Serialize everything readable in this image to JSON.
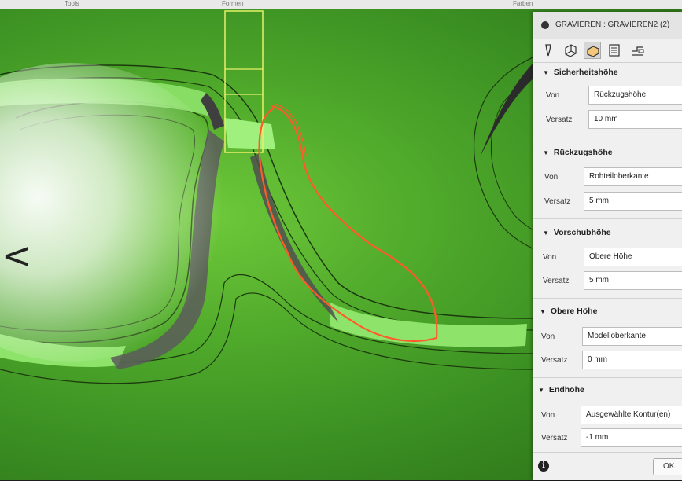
{
  "topbar": {
    "left_text": "Tools",
    "mid_text": "Formen",
    "right_text": "Farben"
  },
  "panel": {
    "title": "GRAVIEREN : GRAVIEREN2 (2)",
    "tabs": [
      "tool-icon",
      "geometry-icon",
      "heights-icon",
      "passes-icon",
      "linking-icon"
    ],
    "sections": [
      {
        "title": "Sicherheitshöhe",
        "from_label": "Von",
        "from_value": "Rückzugshöhe",
        "offset_label": "Versatz",
        "offset_value": "10 mm"
      },
      {
        "title": "Rückzugshöhe",
        "from_label": "Von",
        "from_value": "Rohteiloberkante",
        "offset_label": "Versatz",
        "offset_value": "5 mm"
      },
      {
        "title": "Vorschubhöhe",
        "from_label": "Von",
        "from_value": "Obere Höhe",
        "offset_label": "Versatz",
        "offset_value": "5 mm"
      },
      {
        "title": "Obere Höhe",
        "from_label": "Von",
        "from_value": "Modelloberkante",
        "offset_label": "Versatz",
        "offset_value": "0 mm"
      },
      {
        "title": "Endhöhe",
        "from_label": "Von",
        "from_value": "Ausgewählte Kontur(en)",
        "offset_label": "Versatz",
        "offset_value": "-1 mm"
      }
    ],
    "footer": {
      "info_glyph": "i",
      "ok_label": "OK"
    }
  },
  "nav": {
    "prev_glyph": "<"
  }
}
